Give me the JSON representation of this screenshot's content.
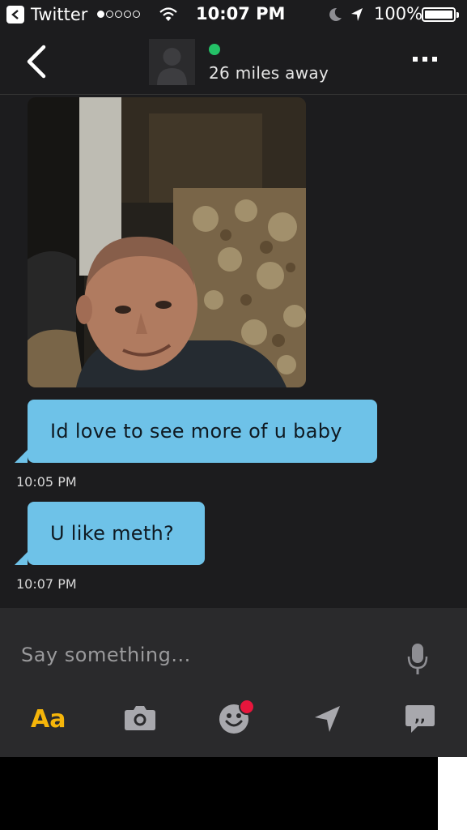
{
  "status_bar": {
    "back_app": "Twitter",
    "time": "10:07 PM",
    "battery": "100%",
    "icons": [
      "wifi-icon",
      "moon-icon",
      "location-arrow-icon",
      "battery-icon"
    ]
  },
  "header": {
    "distance": "26 miles away",
    "online_color": "#24c167",
    "icons": [
      "back-chevron-icon",
      "avatar-placeholder-icon",
      "more-dots-icon"
    ]
  },
  "messages": [
    {
      "type": "photo"
    },
    {
      "type": "text",
      "text": "Id love to see more of u baby",
      "time": "10:05 PM"
    },
    {
      "type": "text",
      "text": "U like meth?",
      "time": "10:07 PM"
    }
  ],
  "composer": {
    "placeholder": "Say something...",
    "text_button": "Aa",
    "icons": [
      "microphone-icon",
      "camera-icon",
      "emoji-icon",
      "location-icon",
      "saved-phrases-icon"
    ],
    "accent": "#f5b50a",
    "bubble_color": "#6ec2e8",
    "badge_color": "#e8163c"
  }
}
